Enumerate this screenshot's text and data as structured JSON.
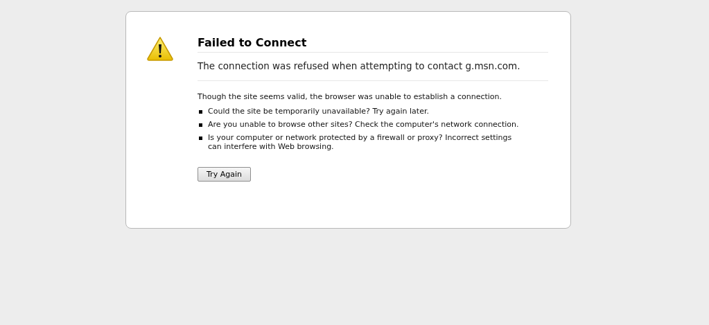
{
  "title": "Failed to Connect",
  "short_description": "The connection was refused when attempting to contact g.msn.com.",
  "long_description": "Though the site seems valid, the browser was unable to establish a connection.",
  "suggestions": [
    "Could the site be temporarily unavailable? Try again later.",
    "Are you unable to browse other sites? Check the computer's network connection.",
    "Is your computer or network protected by a firewall or proxy? Incorrect settings can interfere with Web browsing."
  ],
  "button": "Try Again"
}
